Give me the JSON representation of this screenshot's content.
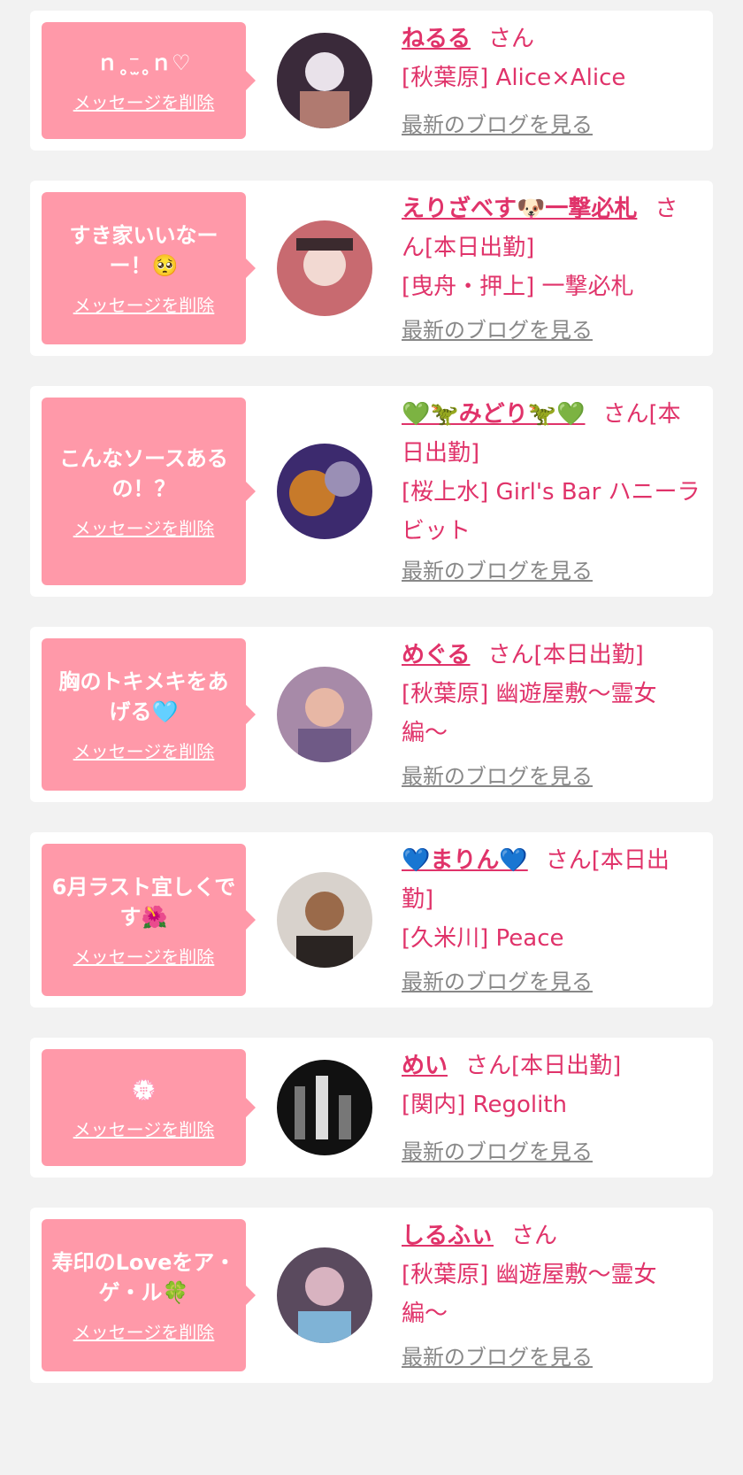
{
  "delete_label": "メッセージを削除",
  "blog_label": "最新のブログを見る",
  "cards": [
    {
      "message": "ｎ˳⁻̫˳ｎ♡",
      "name": "ねるる",
      "suffix": "さん",
      "shop": "[秋葉原] Alice×Alice",
      "avatar_colors": [
        "#3a2a3a",
        "#e9e2ea",
        "#b07a70"
      ]
    },
    {
      "message": "すき家いいなーー！🥺",
      "name": "えりざべす🐶一撃必札",
      "suffix": "さん[本日出勤]",
      "shop": "[曳舟・押上] 一撃必札",
      "avatar_colors": [
        "#c86a70",
        "#f2d9d2",
        "#3b2a2e"
      ]
    },
    {
      "message": "こんなソースあるの！？",
      "name": "💚🦖みどり🦖💚",
      "suffix": "さん[本日出勤]",
      "shop": "[桜上水] Girl's Bar ハニーラビット",
      "avatar_colors": [
        "#3c2a6e",
        "#c77a2a",
        "#9a8fb5"
      ]
    },
    {
      "message": "胸のトキメキをあげる🩵",
      "name": "めぐる",
      "suffix": "さん[本日出勤]",
      "shop": "[秋葉原] 幽遊屋敷〜霊女編〜",
      "avatar_colors": [
        "#a78aa8",
        "#e7b7a5",
        "#6f5a86"
      ]
    },
    {
      "message": "6月ラスト宜しくです🌺",
      "name": "💙まりん💙",
      "suffix": "さん[本日出勤]",
      "shop": "[久米川] Peace",
      "avatar_colors": [
        "#d8d2cc",
        "#9a6a4a",
        "#2a2422"
      ]
    },
    {
      "message": "💮",
      "name": "めい",
      "suffix": "さん[本日出勤]",
      "shop": "[関内] Regolith",
      "avatar_colors": [
        "#111111",
        "#777777",
        "#dddddd"
      ]
    },
    {
      "message": "寿印のLoveをア・ゲ・ル🍀",
      "name": "しるふぃ",
      "suffix": "さん",
      "shop": "[秋葉原] 幽遊屋敷〜霊女編〜",
      "avatar_colors": [
        "#5a4a5e",
        "#d8b3c0",
        "#7fb3d6"
      ]
    }
  ]
}
